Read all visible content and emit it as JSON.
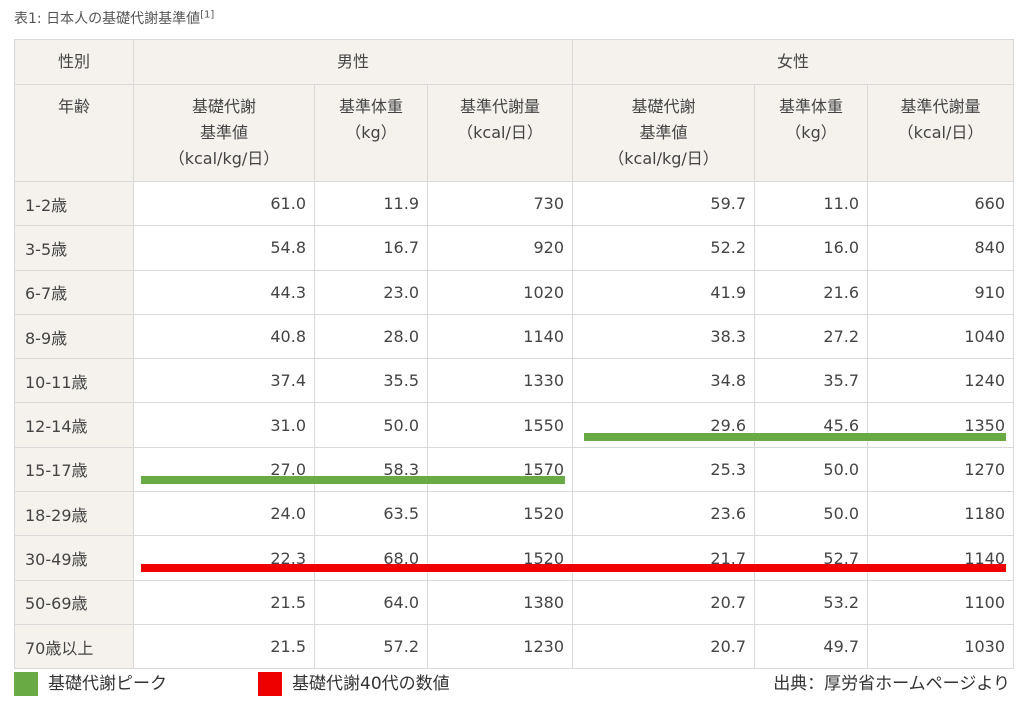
{
  "caption": {
    "text": "表1: 日本人の基礎代謝基準値",
    "ref": "[1]"
  },
  "header": {
    "sex_label": "性別",
    "male_label": "男性",
    "female_label": "女性",
    "age_label": "年齢",
    "columns": [
      [
        "基礎代謝",
        "基準値",
        "（kcal/kg/日）"
      ],
      [
        "基準体重",
        "（kg）"
      ],
      [
        "基準代謝量",
        "（kcal/日）"
      ],
      [
        "基礎代謝",
        "基準値",
        "（kcal/kg/日）"
      ],
      [
        "基準体重",
        "（kg）"
      ],
      [
        "基準代謝量",
        "（kcal/日）"
      ]
    ]
  },
  "rows": [
    {
      "age": "1-2歳",
      "values": [
        "61.0",
        "11.9",
        "730",
        "59.7",
        "11.0",
        "660"
      ]
    },
    {
      "age": "3-5歳",
      "values": [
        "54.8",
        "16.7",
        "920",
        "52.2",
        "16.0",
        "840"
      ]
    },
    {
      "age": "6-7歳",
      "values": [
        "44.3",
        "23.0",
        "1020",
        "41.9",
        "21.6",
        "910"
      ]
    },
    {
      "age": "8-9歳",
      "values": [
        "40.8",
        "28.0",
        "1140",
        "38.3",
        "27.2",
        "1040"
      ]
    },
    {
      "age": "10-11歳",
      "values": [
        "37.4",
        "35.5",
        "1330",
        "34.8",
        "35.7",
        "1240"
      ]
    },
    {
      "age": "12-14歳",
      "values": [
        "31.0",
        "50.0",
        "1550",
        "29.6",
        "45.6",
        "1350"
      ]
    },
    {
      "age": "15-17歳",
      "values": [
        "27.0",
        "58.3",
        "1570",
        "25.3",
        "50.0",
        "1270"
      ]
    },
    {
      "age": "18-29歳",
      "values": [
        "24.0",
        "63.5",
        "1520",
        "23.6",
        "50.0",
        "1180"
      ]
    },
    {
      "age": "30-49歳",
      "values": [
        "22.3",
        "68.0",
        "1520",
        "21.7",
        "52.7",
        "1140"
      ]
    },
    {
      "age": "50-69歳",
      "values": [
        "21.5",
        "64.0",
        "1380",
        "20.7",
        "53.2",
        "1100"
      ]
    },
    {
      "age": "70歳以上",
      "values": [
        "21.5",
        "57.2",
        "1230",
        "20.7",
        "49.7",
        "1030"
      ]
    }
  ],
  "legend": [
    {
      "label": "基礎代謝ピーク",
      "color": "#6aaa45"
    },
    {
      "label": "基礎代謝40代の数値",
      "color": "#ee0000"
    }
  ],
  "source": "出典：厚労省ホームページより",
  "colors": {
    "header_bg": "#f5f2ee",
    "border": "#d9d9d9",
    "peak": "#6aaa45",
    "forties": "#ee0000"
  }
}
